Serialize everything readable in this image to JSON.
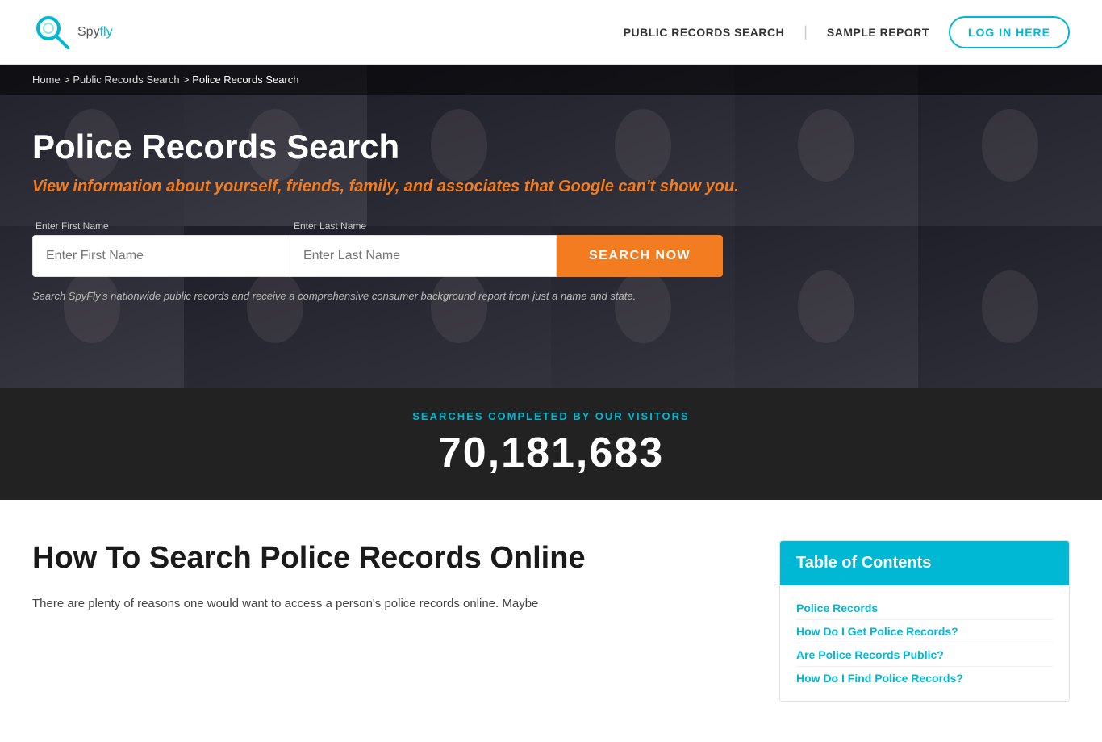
{
  "header": {
    "logo_spy": "Spy",
    "logo_fly": "fly",
    "nav": {
      "public_records": "PUBLIC RECORDS SEARCH",
      "sample_report": "SAMPLE REPORT",
      "login": "LOG IN HERE"
    }
  },
  "breadcrumb": {
    "home": "Home",
    "sep1": " > ",
    "public_records": "Public Records Search",
    "sep2": " > ",
    "current": "Police Records Search"
  },
  "hero": {
    "title": "Police Records Search",
    "subtitle": "View information about yourself, friends, family, and associates that Google can't show you.",
    "first_name_label": "Enter First Name",
    "first_name_placeholder": "Enter First Name",
    "last_name_label": "Enter Last Name",
    "last_name_placeholder": "Enter Last Name",
    "search_btn": "SEARCH NOW",
    "disclaimer": "Search SpyFly's nationwide public records and receive a comprehensive consumer background report from just a name and state."
  },
  "stats": {
    "label": "SEARCHES COMPLETED BY OUR VISITORS",
    "number": "70,181,683"
  },
  "main_content": {
    "title": "How To Search Police Records Online",
    "paragraph": "There are plenty of reasons one would want to access a person's police records online. Maybe"
  },
  "toc": {
    "header": "Table of Contents",
    "links": [
      "Police Records",
      "How Do I Get Police Records?",
      "Are Police Records Public?",
      "How Do I Find Police Records?"
    ]
  }
}
